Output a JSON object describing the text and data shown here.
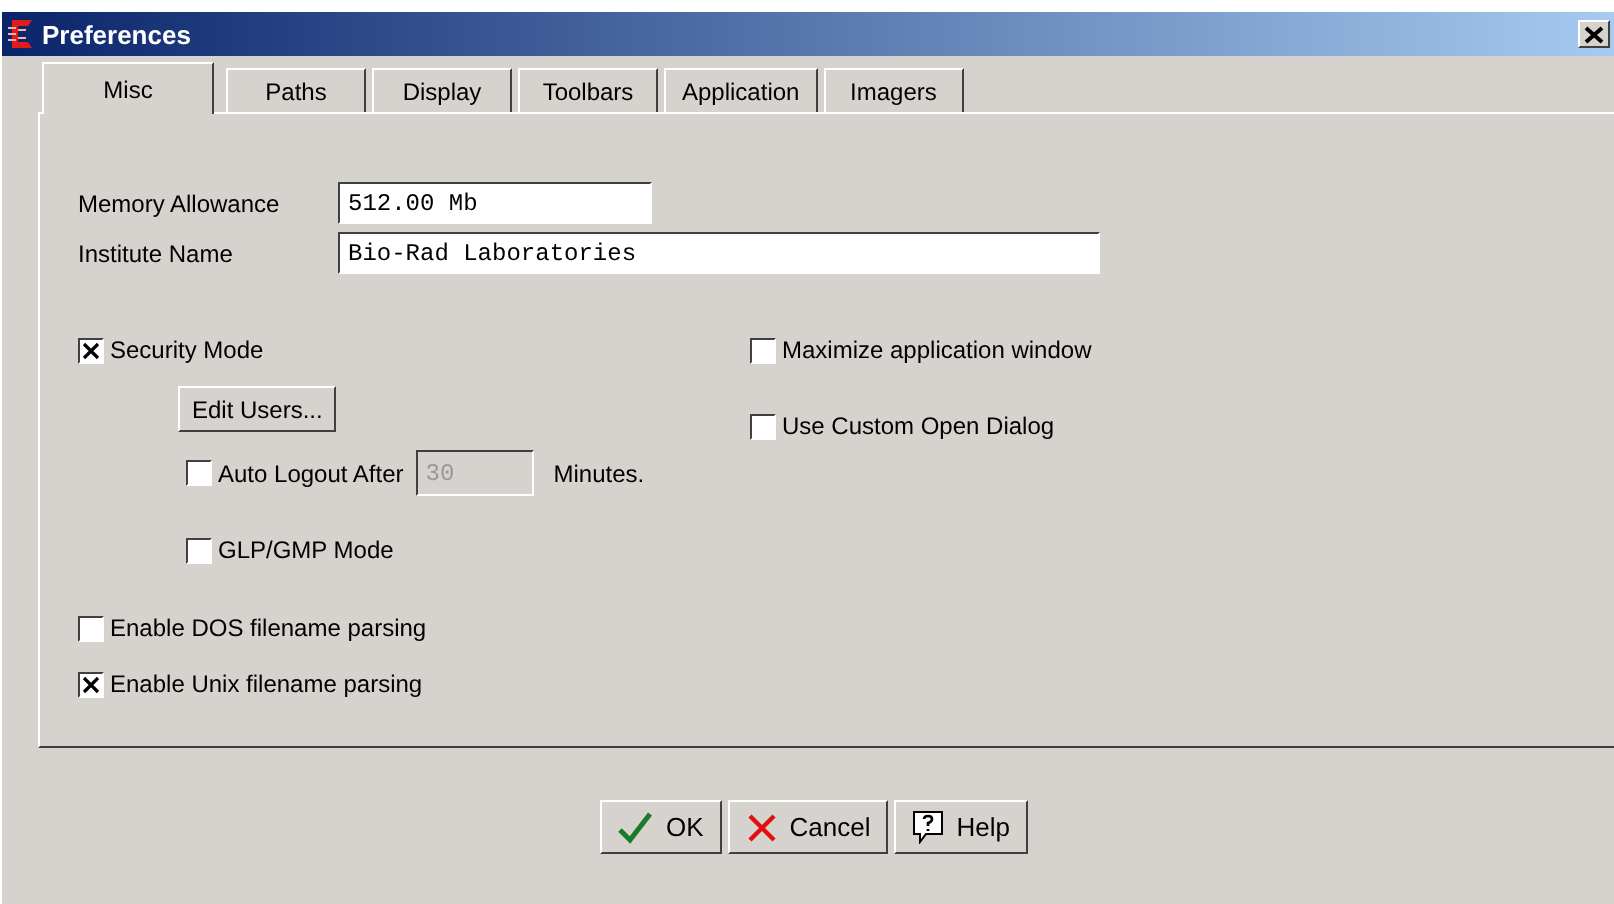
{
  "window": {
    "title": "Preferences"
  },
  "tabs": [
    {
      "label": "Misc",
      "selected": true
    },
    {
      "label": "Paths",
      "selected": false
    },
    {
      "label": "Display",
      "selected": false
    },
    {
      "label": "Toolbars",
      "selected": false
    },
    {
      "label": "Application",
      "selected": false
    },
    {
      "label": "Imagers",
      "selected": false
    }
  ],
  "fields": [
    {
      "label": "Memory Allowance",
      "value": "512.00 Mb"
    },
    {
      "label": "Institute Name",
      "value": "Bio-Rad Laboratories"
    }
  ],
  "security_mode": {
    "label": "Security Mode",
    "checked": true
  },
  "edit_users_button": "Edit Users...",
  "auto_logout": {
    "label": "Auto Logout After",
    "checked": false,
    "value": "30",
    "disabled": true,
    "unit": "Minutes."
  },
  "glp_gmp_mode": {
    "label": "GLP/GMP Mode",
    "checked": false
  },
  "parsing_options": [
    {
      "label": "Enable DOS filename parsing",
      "checked": false
    },
    {
      "label": "Enable Unix filename parsing",
      "checked": true
    }
  ],
  "right_options": [
    {
      "label": "Maximize application window",
      "checked": false
    },
    {
      "label": "Use Custom Open Dialog",
      "checked": false
    }
  ],
  "buttons": [
    {
      "kind": "ok",
      "label": "OK"
    },
    {
      "kind": "cancel",
      "label": "Cancel"
    },
    {
      "kind": "help",
      "label": "Help"
    }
  ]
}
